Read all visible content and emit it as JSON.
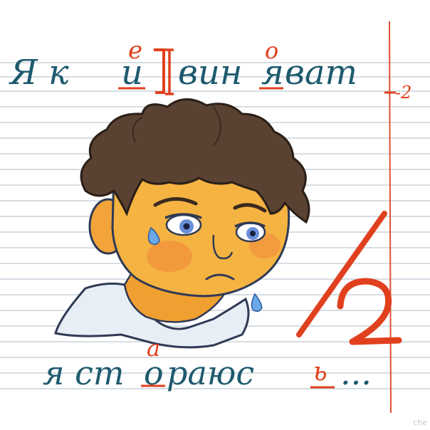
{
  "line1": {
    "text_before": "Я к",
    "crossed_letter": "и",
    "correction_letter": "е",
    "text_after_bracket": "вин",
    "crossed_letter_2": "я",
    "correction_letter_2": "о",
    "text_end": "ват",
    "margin_mark": "-2"
  },
  "line2": {
    "text_before": "я ст",
    "crossed_letter": "о",
    "correction_letter": "а",
    "text_mid": "раюс",
    "added_letter": "ь",
    "ellipsis": "..."
  },
  "grade": "/2",
  "watermark": "che",
  "colors": {
    "ink": "#1e5a6e",
    "teacher_red": "#e0401e",
    "rule_lines": "#c9d3dc",
    "margin_line": "#e05030",
    "hair": "#5a4232",
    "skin": "#f5b341",
    "shirt": "#e8eef5",
    "tears": "#6aa8e8"
  },
  "icons": [
    "crying-boy-illustration",
    "tear-drop-icon"
  ]
}
